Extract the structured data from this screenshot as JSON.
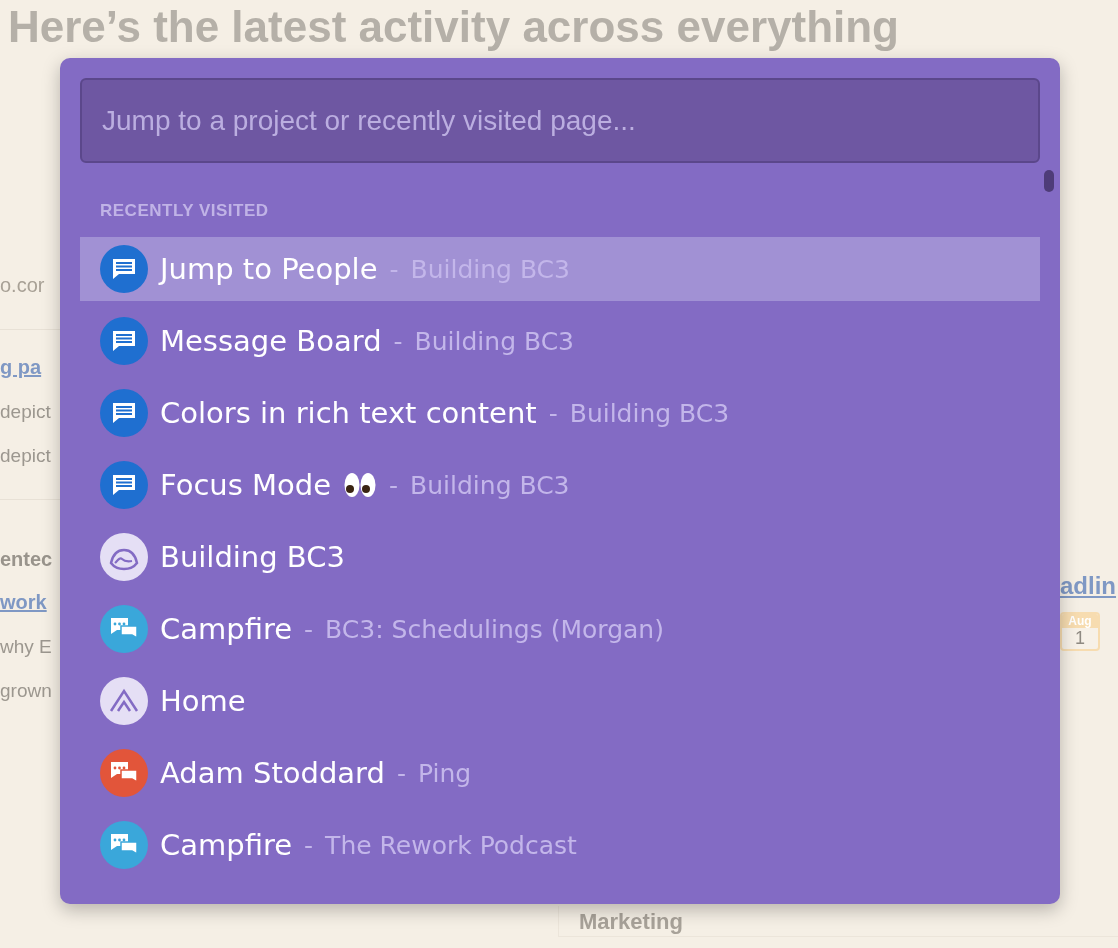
{
  "background": {
    "heading": "Here’s the latest activity across everything",
    "left": [
      {
        "kind": "faint",
        "text": "o.cor"
      },
      {
        "kind": "rule"
      },
      {
        "kind": "link",
        "text": "g pa"
      },
      {
        "kind": "text",
        "text": "depict"
      },
      {
        "kind": "text",
        "text": "depict"
      },
      {
        "kind": "rule"
      },
      {
        "kind": "bold",
        "text": "entec"
      },
      {
        "kind": "link",
        "text": "work"
      },
      {
        "kind": "text",
        "text": "why E"
      },
      {
        "kind": "text",
        "text": "grown"
      }
    ],
    "right": {
      "link": "adlin",
      "date_month": "Aug",
      "date_day": "1"
    },
    "bottom": "Marketing"
  },
  "jump_menu": {
    "search": {
      "placeholder": "Jump to a project or recently visited page..."
    },
    "section_label": "RECENTLY VISITED",
    "items": [
      {
        "kind": "message",
        "title": "Jump to People",
        "eyes": false,
        "separator": "-",
        "context": "Building BC3",
        "selected": true
      },
      {
        "kind": "message",
        "title": "Message Board",
        "eyes": false,
        "separator": "-",
        "context": "Building BC3",
        "selected": false
      },
      {
        "kind": "message",
        "title": "Colors in rich text content",
        "eyes": false,
        "separator": "-",
        "context": "Building BC3",
        "selected": false
      },
      {
        "kind": "message",
        "title": "Focus Mode",
        "eyes": true,
        "separator": "-",
        "context": "Building BC3",
        "selected": false
      },
      {
        "kind": "project",
        "title": "Building BC3",
        "eyes": false,
        "selected": false
      },
      {
        "kind": "campfire",
        "title": "Campfire",
        "eyes": false,
        "separator": "-",
        "context": "BC3: Schedulings (Morgan)",
        "selected": false
      },
      {
        "kind": "home",
        "title": "Home",
        "eyes": false,
        "selected": false
      },
      {
        "kind": "ping",
        "title": "Adam Stoddard",
        "eyes": false,
        "separator": "-",
        "context": "Ping",
        "selected": false
      },
      {
        "kind": "campfire",
        "title": "Campfire",
        "eyes": false,
        "separator": "-",
        "context": "The Rework Podcast",
        "selected": false
      }
    ]
  }
}
